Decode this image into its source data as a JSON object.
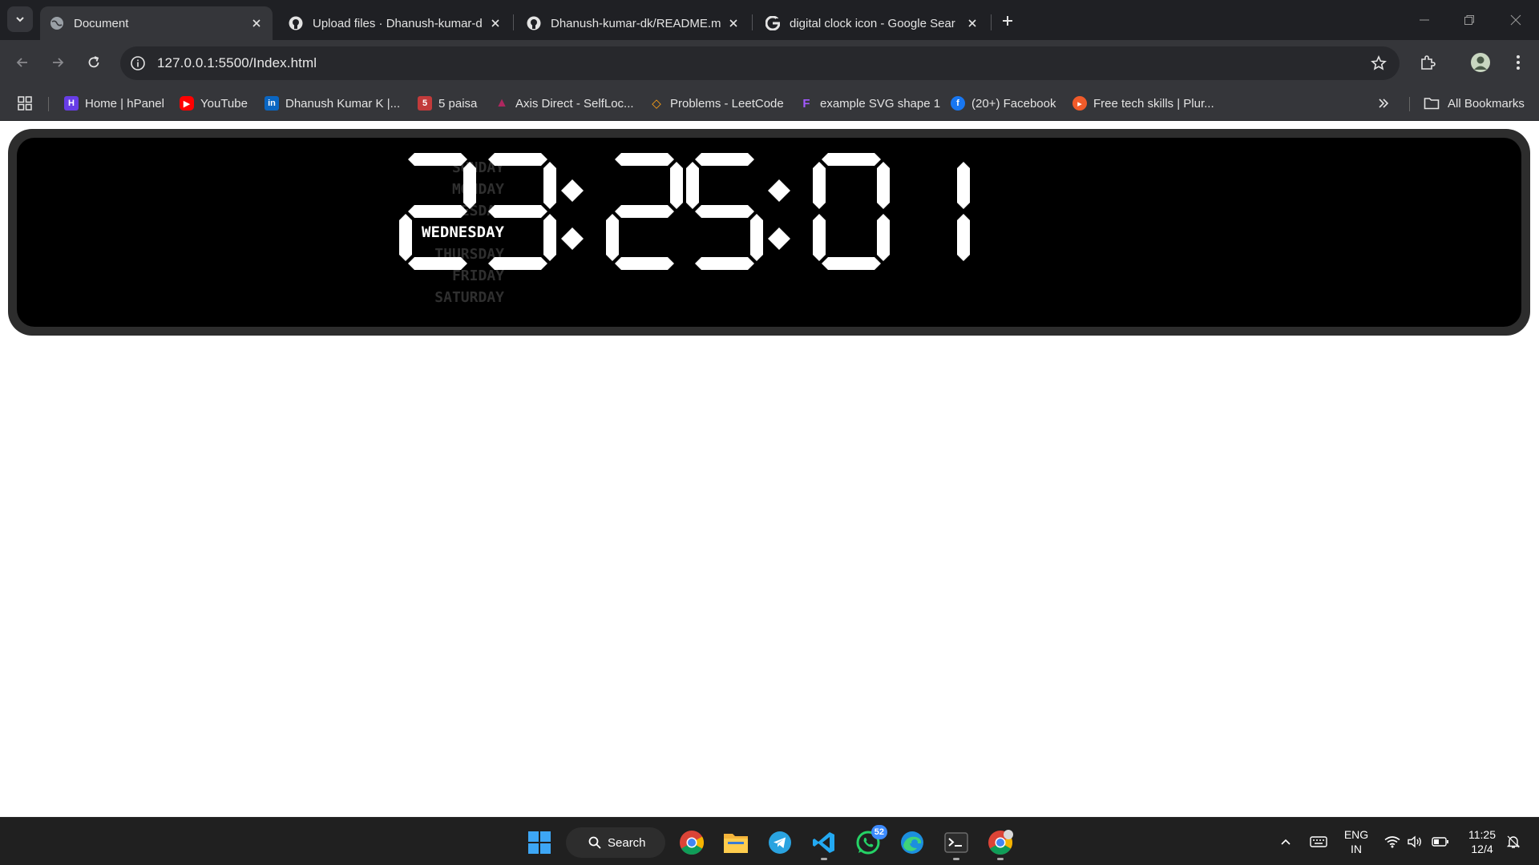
{
  "browser": {
    "tabs": [
      {
        "title": "Document",
        "active": true,
        "favicon": "globe-icon"
      },
      {
        "title": "Upload files · Dhanush-kumar-d",
        "active": false,
        "favicon": "github-icon"
      },
      {
        "title": "Dhanush-kumar-dk/README.m",
        "active": false,
        "favicon": "github-icon"
      },
      {
        "title": "digital clock icon - Google Sear",
        "active": false,
        "favicon": "google-icon"
      }
    ],
    "url": "127.0.0.1:5500/Index.html",
    "bookmarks": [
      {
        "label": "Home | hPanel",
        "icon": "hpanel-icon",
        "color": "#673de6"
      },
      {
        "label": "YouTube",
        "icon": "youtube-icon",
        "color": "#ff0000"
      },
      {
        "label": "Dhanush Kumar K |...",
        "icon": "linkedin-icon",
        "color": "#0a66c2"
      },
      {
        "label": "5 paisa",
        "icon": "fivepaisa-icon",
        "color": "#c23b3b"
      },
      {
        "label": "Axis Direct - SelfLoc...",
        "icon": "axis-icon",
        "color": "#ae275f"
      },
      {
        "label": "Problems - LeetCode",
        "icon": "leetcode-icon",
        "color": "#ffa116"
      },
      {
        "label": "example SVG shape 1",
        "icon": "figma-icon",
        "color": "#a259ff"
      },
      {
        "label": "(20+) Facebook",
        "icon": "facebook-icon",
        "color": "#1877f2"
      },
      {
        "label": "Free tech skills | Plur...",
        "icon": "pluralsight-icon",
        "color": "#f15b2a"
      }
    ],
    "all_bookmarks_label": "All Bookmarks"
  },
  "clock": {
    "days": [
      "SUNDAY",
      "MONDAY",
      "TUESDAY",
      "WEDNESDAY",
      "THURSDAY",
      "FRIDAY",
      "SATURDAY"
    ],
    "active_day": "WEDNESDAY",
    "time": "23:25:01",
    "digits": [
      "2",
      "3",
      "2",
      "5",
      "0",
      "1"
    ],
    "colors": {
      "lit": "#ffffff",
      "face": "#000000",
      "frame": "#2d2d2d",
      "day_inactive": "#2f2f2f"
    }
  },
  "taskbar": {
    "search_label": "Search",
    "apps": [
      "windows-start-icon",
      "chrome-icon",
      "file-explorer-icon",
      "telegram-icon",
      "vscode-icon",
      "whatsapp-icon",
      "edge-icon",
      "terminal-icon",
      "chrome-profile-icon"
    ],
    "whatsapp_badge": "52",
    "language": {
      "line1": "ENG",
      "line2": "IN"
    },
    "clock": {
      "time": "11:25",
      "date": "12/4"
    }
  }
}
